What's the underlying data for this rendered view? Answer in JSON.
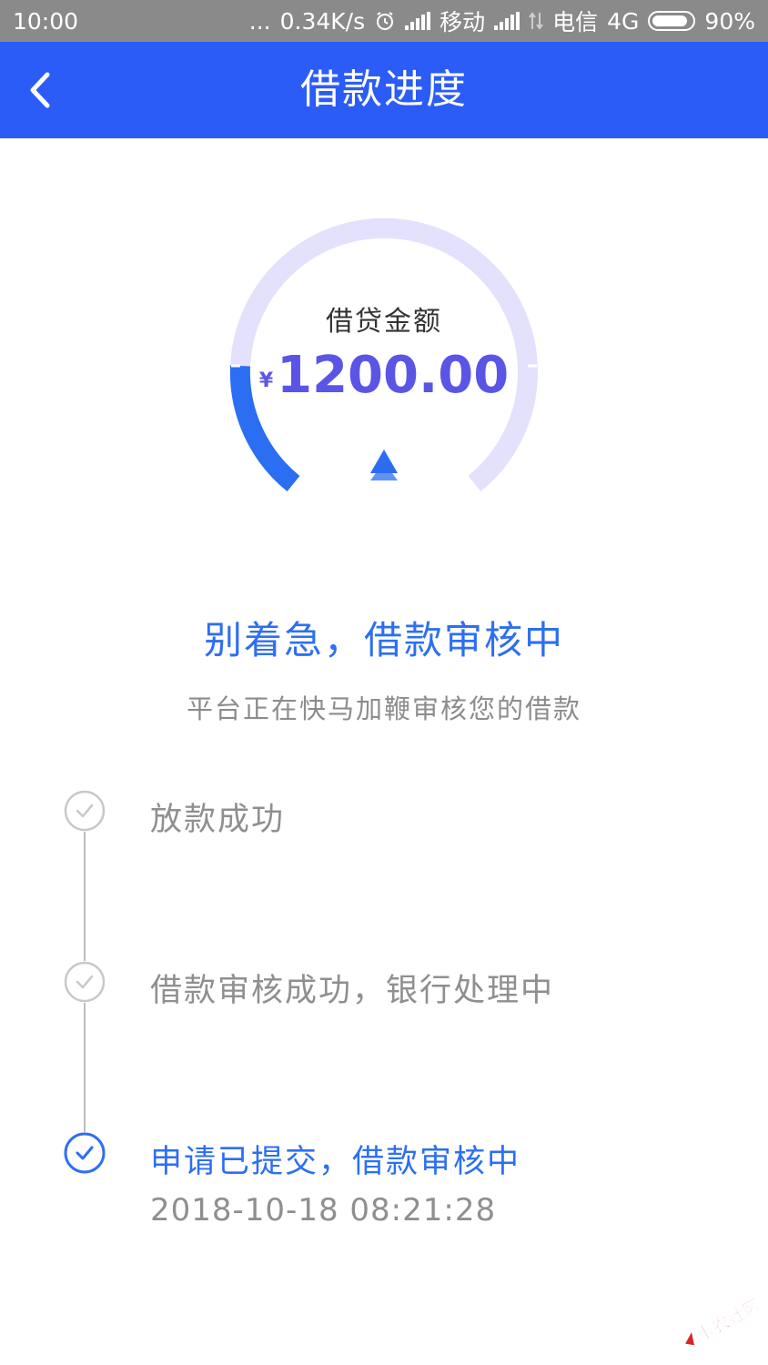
{
  "status_bar": {
    "time": "10:00",
    "dots": "...",
    "speed": "0.34K/s",
    "carrier1": "移动",
    "carrier2": "电信",
    "network": "4G",
    "battery": "90%",
    "battery_level": 0.9
  },
  "header": {
    "title": "借款进度",
    "back_icon": "chevron-left-icon"
  },
  "gauge": {
    "label": "借贷金额",
    "currency": "¥",
    "amount": "1200.00",
    "colors": {
      "track": "#e3e1fb",
      "progress": "#2b6ef2",
      "text": "#5b55e6"
    }
  },
  "status": {
    "title": "别着急，借款审核中",
    "subtitle": "平台正在快马加鞭审核您的借款"
  },
  "timeline": [
    {
      "label": "放款成功",
      "active": false
    },
    {
      "label": "借款审核成功，银行处理中",
      "active": false
    },
    {
      "label": "申请已提交，借款审核中",
      "active": true,
      "time": "2018-10-18 08:21:28"
    }
  ],
  "watermark": {
    "text": "卡农社区"
  },
  "colors": {
    "accent": "#2b5cf7",
    "active": "#2d6ff2",
    "muted": "#8f8f8f"
  }
}
